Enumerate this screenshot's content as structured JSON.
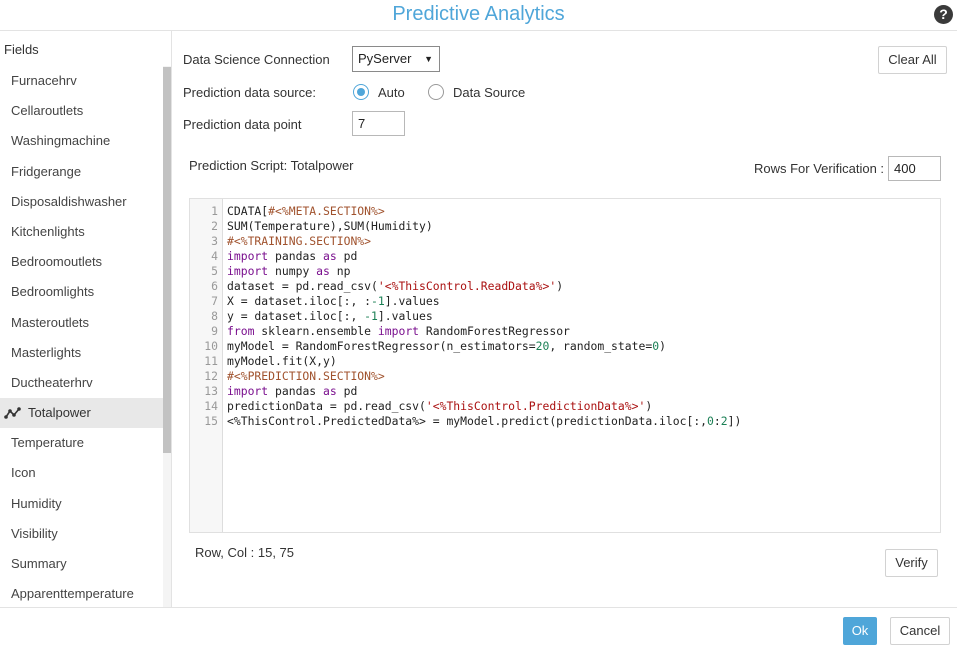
{
  "header": {
    "title": "Predictive Analytics",
    "help_icon": "question-circle-icon"
  },
  "sidebar": {
    "heading": "Fields",
    "items": [
      {
        "label": "Furnacehrv"
      },
      {
        "label": "Cellaroutlets"
      },
      {
        "label": "Washingmachine"
      },
      {
        "label": "Fridgerange"
      },
      {
        "label": "Disposaldishwasher"
      },
      {
        "label": "Kitchenlights"
      },
      {
        "label": "Bedroomoutlets"
      },
      {
        "label": "Bedroomlights"
      },
      {
        "label": "Masteroutlets"
      },
      {
        "label": "Masterlights"
      },
      {
        "label": "Ductheaterhrv"
      },
      {
        "label": "Totalpower",
        "selected": true,
        "icon": "series-icon"
      },
      {
        "label": "Temperature"
      },
      {
        "label": "Icon"
      },
      {
        "label": "Humidity"
      },
      {
        "label": "Visibility"
      },
      {
        "label": "Summary"
      },
      {
        "label": "Apparenttemperature"
      }
    ]
  },
  "form": {
    "connection_label": "Data Science Connection",
    "connection_value": "PyServer",
    "clear_all_label": "Clear All",
    "source_label": "Prediction data source:",
    "source_options": [
      {
        "label": "Auto",
        "checked": true
      },
      {
        "label": "Data Source",
        "checked": false
      }
    ],
    "point_label": "Prediction data point",
    "point_value": "7",
    "script_title": "Prediction Script: Totalpower",
    "rows_label": "Rows For Verification :",
    "rows_value": "400"
  },
  "editor": {
    "lines": [
      [
        [
          "t",
          "CDATA["
        ],
        [
          "c",
          "#<%META.SECTION%>"
        ]
      ],
      [
        [
          "t",
          "SUM(Temperature),SUM(Humidity)"
        ]
      ],
      [
        [
          "c",
          "#<%TRAINING.SECTION%>"
        ]
      ],
      [
        [
          "k",
          "import"
        ],
        [
          "t",
          " pandas "
        ],
        [
          "k",
          "as"
        ],
        [
          "t",
          " pd"
        ]
      ],
      [
        [
          "k",
          "import"
        ],
        [
          "t",
          " numpy "
        ],
        [
          "k",
          "as"
        ],
        [
          "t",
          " np"
        ]
      ],
      [
        [
          "t",
          "dataset = pd.read_csv("
        ],
        [
          "s",
          "'<%ThisControl.ReadData%>'"
        ],
        [
          "t",
          ")"
        ]
      ],
      [
        [
          "t",
          "X = dataset.iloc[:, :"
        ],
        [
          "n",
          "-1"
        ],
        [
          "t",
          "].values"
        ]
      ],
      [
        [
          "t",
          "y = dataset.iloc[:, "
        ],
        [
          "n",
          "-1"
        ],
        [
          "t",
          "].values"
        ]
      ],
      [
        [
          "k",
          "from"
        ],
        [
          "t",
          " sklearn.ensemble "
        ],
        [
          "k",
          "import"
        ],
        [
          "t",
          " RandomForestRegressor"
        ]
      ],
      [
        [
          "t",
          "myModel = RandomForestRegressor(n_estimators="
        ],
        [
          "n",
          "20"
        ],
        [
          "t",
          ", random_state="
        ],
        [
          "n",
          "0"
        ],
        [
          "t",
          ")"
        ]
      ],
      [
        [
          "t",
          "myModel.fit(X,y)"
        ]
      ],
      [
        [
          "c",
          "#<%PREDICTION.SECTION%>"
        ]
      ],
      [
        [
          "k",
          "import"
        ],
        [
          "t",
          " pandas "
        ],
        [
          "k",
          "as"
        ],
        [
          "t",
          " pd"
        ]
      ],
      [
        [
          "t",
          "predictionData = pd.read_csv("
        ],
        [
          "s",
          "'<%ThisControl.PredictionData%>'"
        ],
        [
          "t",
          ")"
        ]
      ],
      [
        [
          "t",
          "<%ThisControl.PredictedData%> = myModel.predict(predictionData.iloc[:,"
        ],
        [
          "n",
          "0"
        ],
        [
          "t",
          ":"
        ],
        [
          "n",
          "2"
        ],
        [
          "t",
          "])"
        ]
      ]
    ],
    "cursor_label": "Row, Col : 15, 75",
    "verify_label": "Verify"
  },
  "footer": {
    "ok_label": "Ok",
    "cancel_label": "Cancel"
  },
  "colors": {
    "accent": "#4fa6d9",
    "keyword": "#7a0f8e",
    "string": "#aa1111",
    "number": "#1a7f54",
    "section_comment": "#a0522d"
  }
}
